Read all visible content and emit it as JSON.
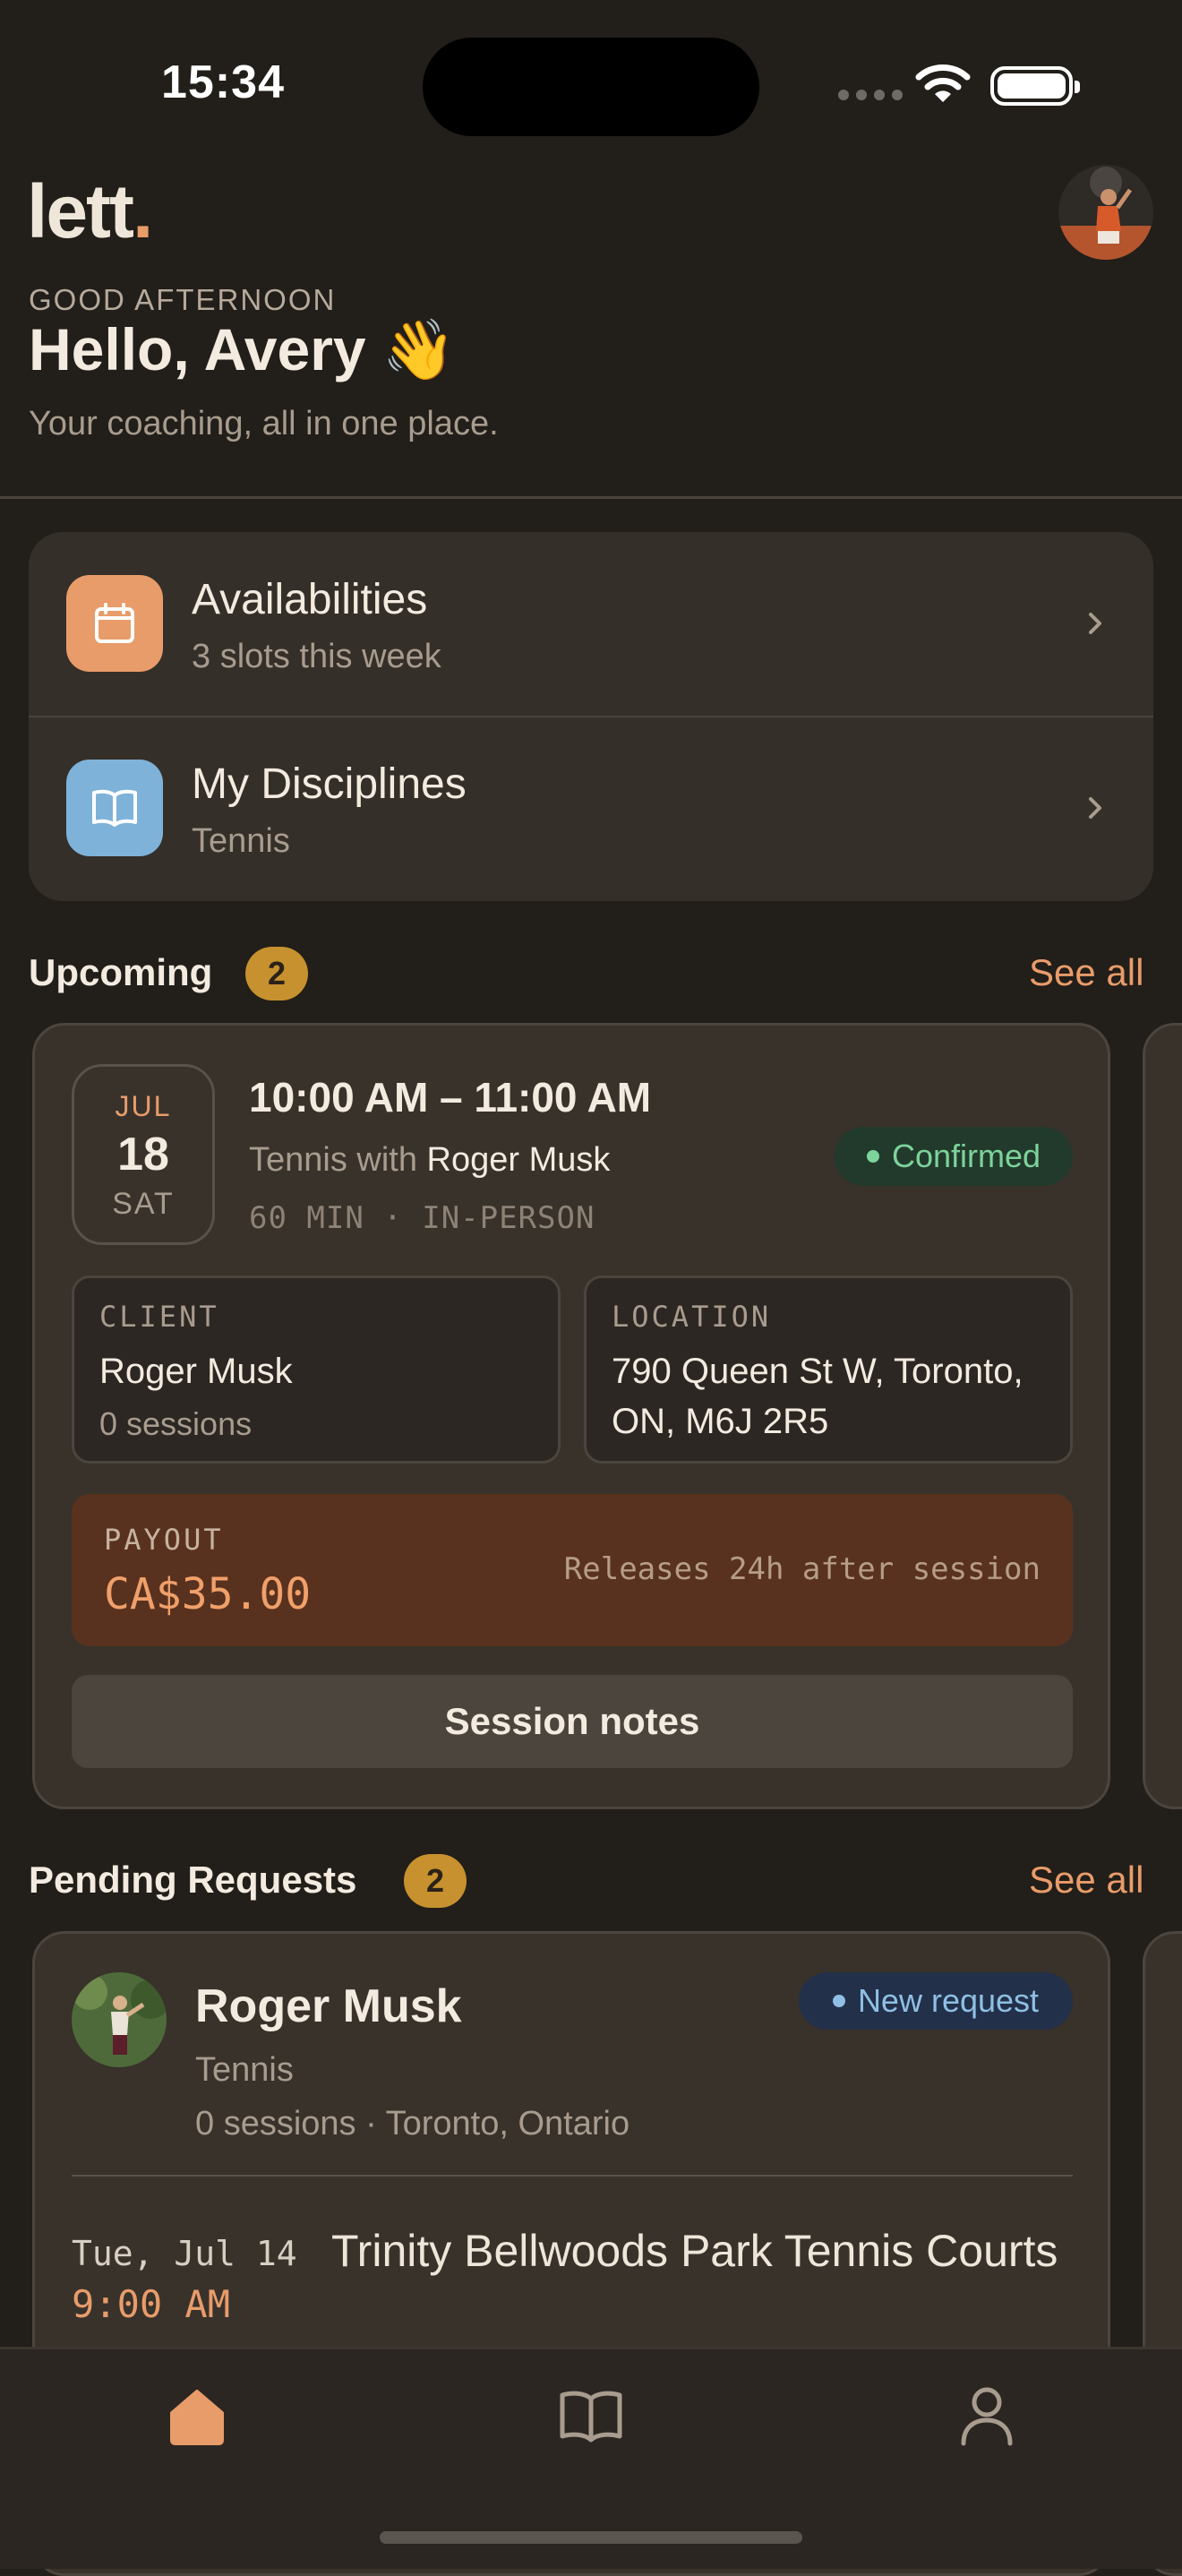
{
  "status_bar": {
    "time": "15:34"
  },
  "header": {
    "logo_text": "lett",
    "logo_dot": ".",
    "eyebrow": "GOOD AFTERNOON",
    "title": "Hello, Avery 👋",
    "subtitle": "Your coaching, all in one place."
  },
  "nav": {
    "items": [
      {
        "title": "Availabilities",
        "subtitle": "3 slots this week",
        "icon": "calendar-icon",
        "color": "#e89c6a"
      },
      {
        "title": "My Disciplines",
        "subtitle": "Tennis",
        "icon": "book-icon",
        "color": "#7eb2d8"
      }
    ]
  },
  "upcoming": {
    "title": "Upcoming",
    "count": "2",
    "see_all": "See all",
    "session": {
      "month": "JUL",
      "day": "18",
      "weekday": "SAT",
      "time_range": "10:00 AM – 11:00 AM",
      "with_prefix": "Tennis with ",
      "with_name": "Roger Musk",
      "meta": "60 MIN · IN-PERSON",
      "status": "Confirmed",
      "client_label": "CLIENT",
      "client_name": "Roger Musk",
      "client_sessions": "0 sessions",
      "location_label": "LOCATION",
      "location_value": "790 Queen St W, Toronto, ON, M6J 2R5",
      "payout_label": "PAYOUT",
      "payout_amount": "CA$35.00",
      "payout_note": "Releases 24h after session",
      "notes_button": "Session notes"
    }
  },
  "pending": {
    "title": "Pending Requests",
    "count": "2",
    "see_all": "See all",
    "request": {
      "name": "Roger Musk",
      "discipline": "Tennis",
      "meta": "0 sessions · Toronto, Ontario",
      "status": "New request",
      "date": "Tue, Jul 14",
      "time": "9:00 AM",
      "place": "Trinity Bellwoods Park Tennis Courts"
    }
  },
  "tabs": [
    {
      "name": "home",
      "icon": "home-icon",
      "active": true
    },
    {
      "name": "disciplines",
      "icon": "book-icon",
      "active": false
    },
    {
      "name": "profile",
      "icon": "person-icon",
      "active": false
    }
  ],
  "colors": {
    "accent": "#e89c6a",
    "background": "#221e19",
    "card": "#352f29",
    "confirmed": "#7dd39a",
    "new_request": "#8fbfe4",
    "badge": "#c6912e"
  }
}
